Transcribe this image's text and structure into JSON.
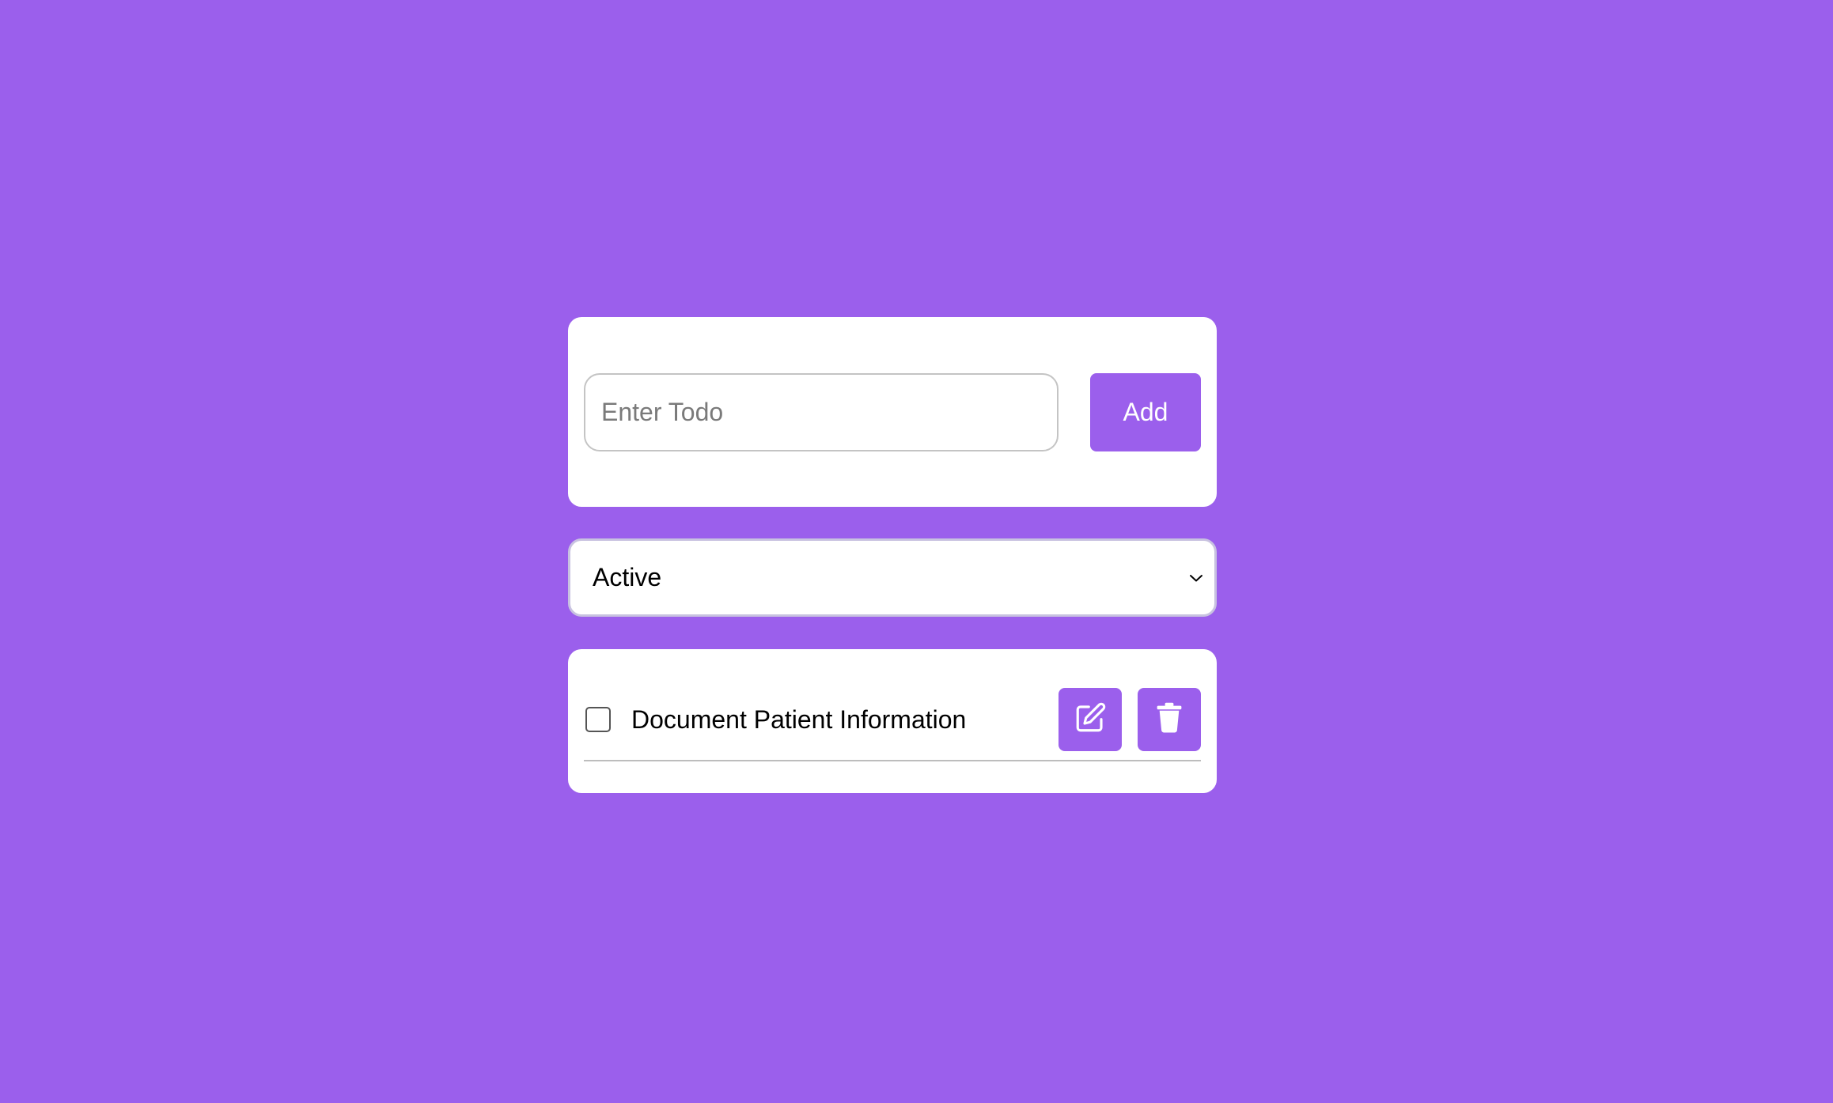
{
  "colors": {
    "background": "#9b5fec",
    "accent": "#9b5fec",
    "card": "#ffffff"
  },
  "add_form": {
    "input_placeholder": "Enter Todo",
    "input_value": "",
    "add_label": "Add"
  },
  "filter": {
    "selected": "Active",
    "icon": "chevron-down-icon"
  },
  "todos": [
    {
      "text": "Document Patient Information",
      "completed": false,
      "edit_icon": "edit-icon",
      "delete_icon": "trash-icon"
    }
  ]
}
